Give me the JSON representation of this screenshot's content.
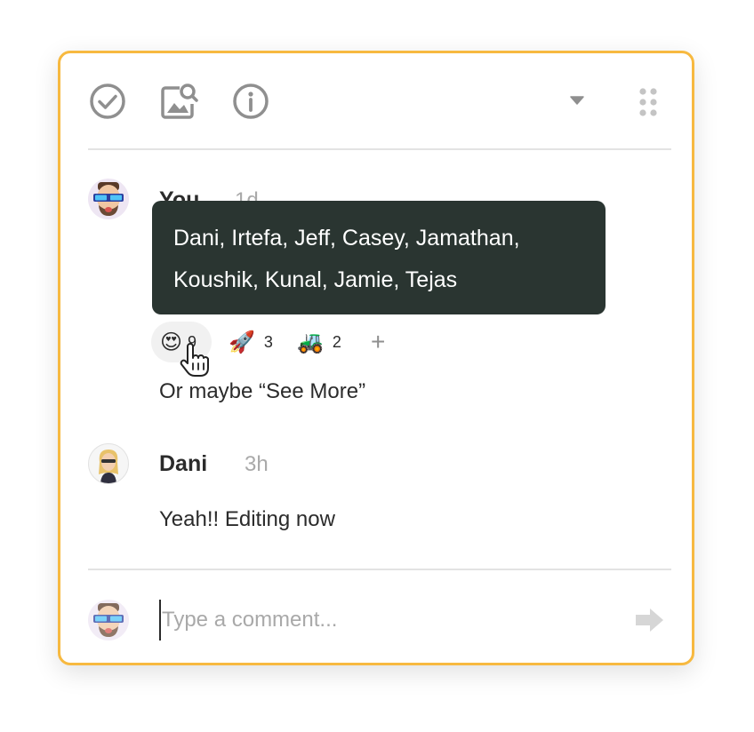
{
  "toolbar": {
    "icons": [
      "check-circle-icon",
      "image-search-icon",
      "info-icon",
      "caret-down-icon",
      "drag-handle-icon"
    ]
  },
  "comments": [
    {
      "author": "You",
      "time": "1d",
      "text": "Or maybe “See More”"
    },
    {
      "author": "Dani",
      "time": "3h",
      "text": "Yeah!! Editing now"
    }
  ],
  "reactions": [
    {
      "emoji": "😍",
      "count": "9",
      "icon": "heart-eyes-emoji-icon"
    },
    {
      "emoji": "🚀",
      "count": "3",
      "icon": "rocket-emoji-icon"
    },
    {
      "emoji": "🚜",
      "count": "2",
      "icon": "tractor-emoji-icon"
    }
  ],
  "add_reaction": "+",
  "tooltip": {
    "line1": "Dani, Irtefa, Jeff, Casey, Jamathan,",
    "line2": "Koushik, Kunal, Jamie, Tejas"
  },
  "comment_input": {
    "placeholder": "Type a comment..."
  },
  "colors": {
    "accent_border": "#f7b940",
    "tooltip_bg": "#2a3531",
    "icon_gray": "#8f8f8f"
  }
}
